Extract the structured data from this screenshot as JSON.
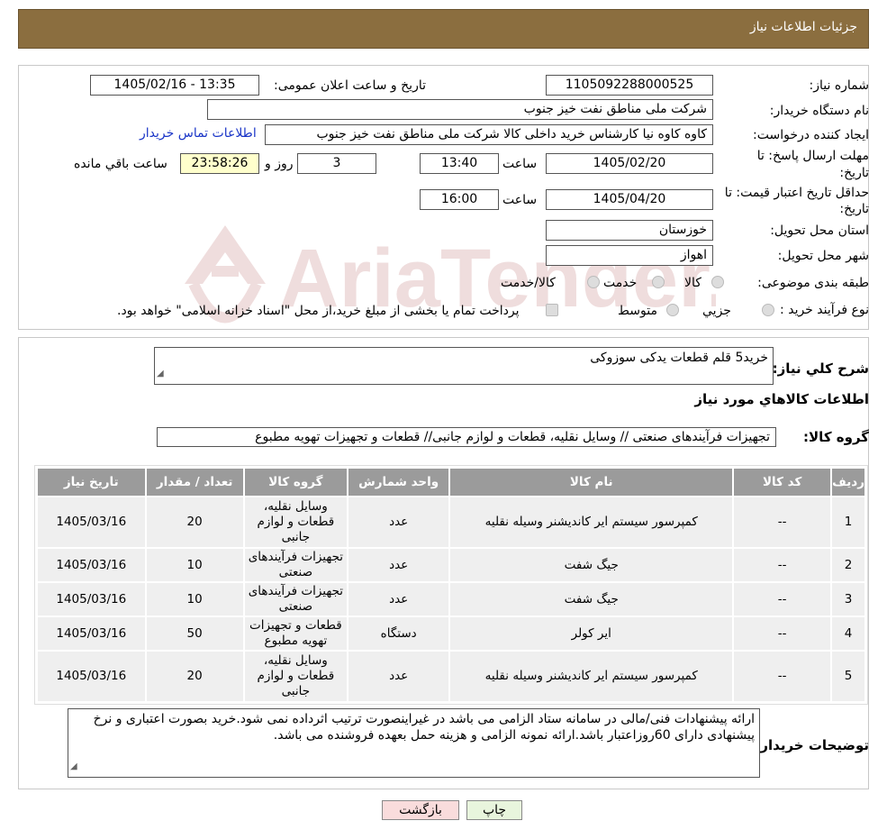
{
  "header": {
    "title": "جزئیات اطلاعات نیاز"
  },
  "info": {
    "need_number_label": "شماره نیاز:",
    "need_number": "1105092288000525",
    "announce_label": "تاریخ و ساعت اعلان عمومی:",
    "announce_value": "1405/02/16 - 13:35",
    "buyer_org_label": "نام دستگاه خریدار:",
    "buyer_org": "شرکت ملی مناطق نفت خیز جنوب",
    "requester_label": "ایجاد کننده درخواست:",
    "requester": "کاوه کاوه نیا کارشناس خرید داخلی کالا  شرکت ملی مناطق نفت خیز جنوب",
    "contact_link": "اطلاعات تماس خریدار",
    "deadline_label_1": "مهلت ارسال پاسخ: تا",
    "deadline_label_2": "تاریخ:",
    "deadline_date": "1405/02/20",
    "time_label": "ساعت",
    "deadline_time": "13:40",
    "days_value": "3",
    "days_label": "روز و",
    "remaining_time": "23:58:26",
    "remaining_label": "ساعت باقي مانده",
    "validity_label_1": "حداقل تاریخ اعتبار قیمت: تا",
    "validity_label_2": "تاریخ:",
    "validity_date": "1405/04/20",
    "validity_time": "16:00",
    "province_label": "استان محل تحویل:",
    "province": "خوزستان",
    "city_label": "شهر محل تحویل:",
    "city": "اهواز",
    "category_label": "طبقه بندی موضوعی:",
    "category_options": [
      "کالا",
      "خدمت",
      "کالا/خدمت"
    ],
    "process_label": "نوع فرآیند خرید :",
    "process_options": [
      "جزیي",
      "متوسط"
    ],
    "process_note": "پرداخت تمام یا بخشی از مبلغ خرید،از محل \"اسناد خزانه اسلامی\" خواهد بود."
  },
  "details": {
    "summary_label": "شرح کلي نیاز:",
    "summary": "خرید5 قلم قطعات یدکی سوزوکی",
    "goods_info_title": "اطلاعات کالاهاي مورد نیاز",
    "goods_group_label": "گروه کالا:",
    "goods_group": "تجهیزات فرآیندهای صنعتی // وسایل نقلیه، قطعات و لوازم جانبی//  قطعات و تجهیزات تهویه مطبوع"
  },
  "table": {
    "headers": [
      "ردیف",
      "کد کالا",
      "نام کالا",
      "واحد شمارش",
      "گروه کالا",
      "تعداد / مقدار",
      "تاریخ نیاز"
    ],
    "rows": [
      {
        "row": "1",
        "code": "--",
        "name": "کمپرسور سیستم ایر کاندیشنر وسیله نقلیه",
        "unit": "عدد",
        "group": "وسایل نقلیه، قطعات و لوازم جانبی",
        "qty": "20",
        "date": "1405/03/16"
      },
      {
        "row": "2",
        "code": "--",
        "name": "جیگ شفت",
        "unit": "عدد",
        "group": "تجهیزات فرآیندهای صنعتی",
        "qty": "10",
        "date": "1405/03/16"
      },
      {
        "row": "3",
        "code": "--",
        "name": "جیگ شفت",
        "unit": "عدد",
        "group": "تجهیزات فرآیندهای صنعتی",
        "qty": "10",
        "date": "1405/03/16"
      },
      {
        "row": "4",
        "code": "--",
        "name": "ایر کولر",
        "unit": "دستگاه",
        "group": "قطعات و تجهیزات تهویه مطبوع",
        "qty": "50",
        "date": "1405/03/16"
      },
      {
        "row": "5",
        "code": "--",
        "name": "کمپرسور سیستم ایر کاندیشنر وسیله نقلیه",
        "unit": "عدد",
        "group": "وسایل نقلیه، قطعات و لوازم جانبی",
        "qty": "20",
        "date": "1405/03/16"
      }
    ]
  },
  "notes": {
    "label": "توضیحات خریدار:",
    "text": "ارائه پیشنهادات فنی/مالی در سامانه ستاد الزامی می باشد در غیراینصورت ترتیب اثرداده نمی شود.خرید بصورت اعتباری و نرخ پیشنهادی دارای 60روزاعتبار باشد.ارائه نمونه الزامی و هزینه حمل بعهده فروشنده می باشد."
  },
  "buttons": {
    "print": "چاپ",
    "back": "بازگشت"
  },
  "watermark": {
    "text": "AriaTender.neT"
  },
  "colors": {
    "header": "#8B6E3F",
    "table_header": "#9b9b9b",
    "remaining_bg": "#FFFFCC",
    "back_button": "#F9DCDC",
    "print_button": "#E8F5DD"
  }
}
